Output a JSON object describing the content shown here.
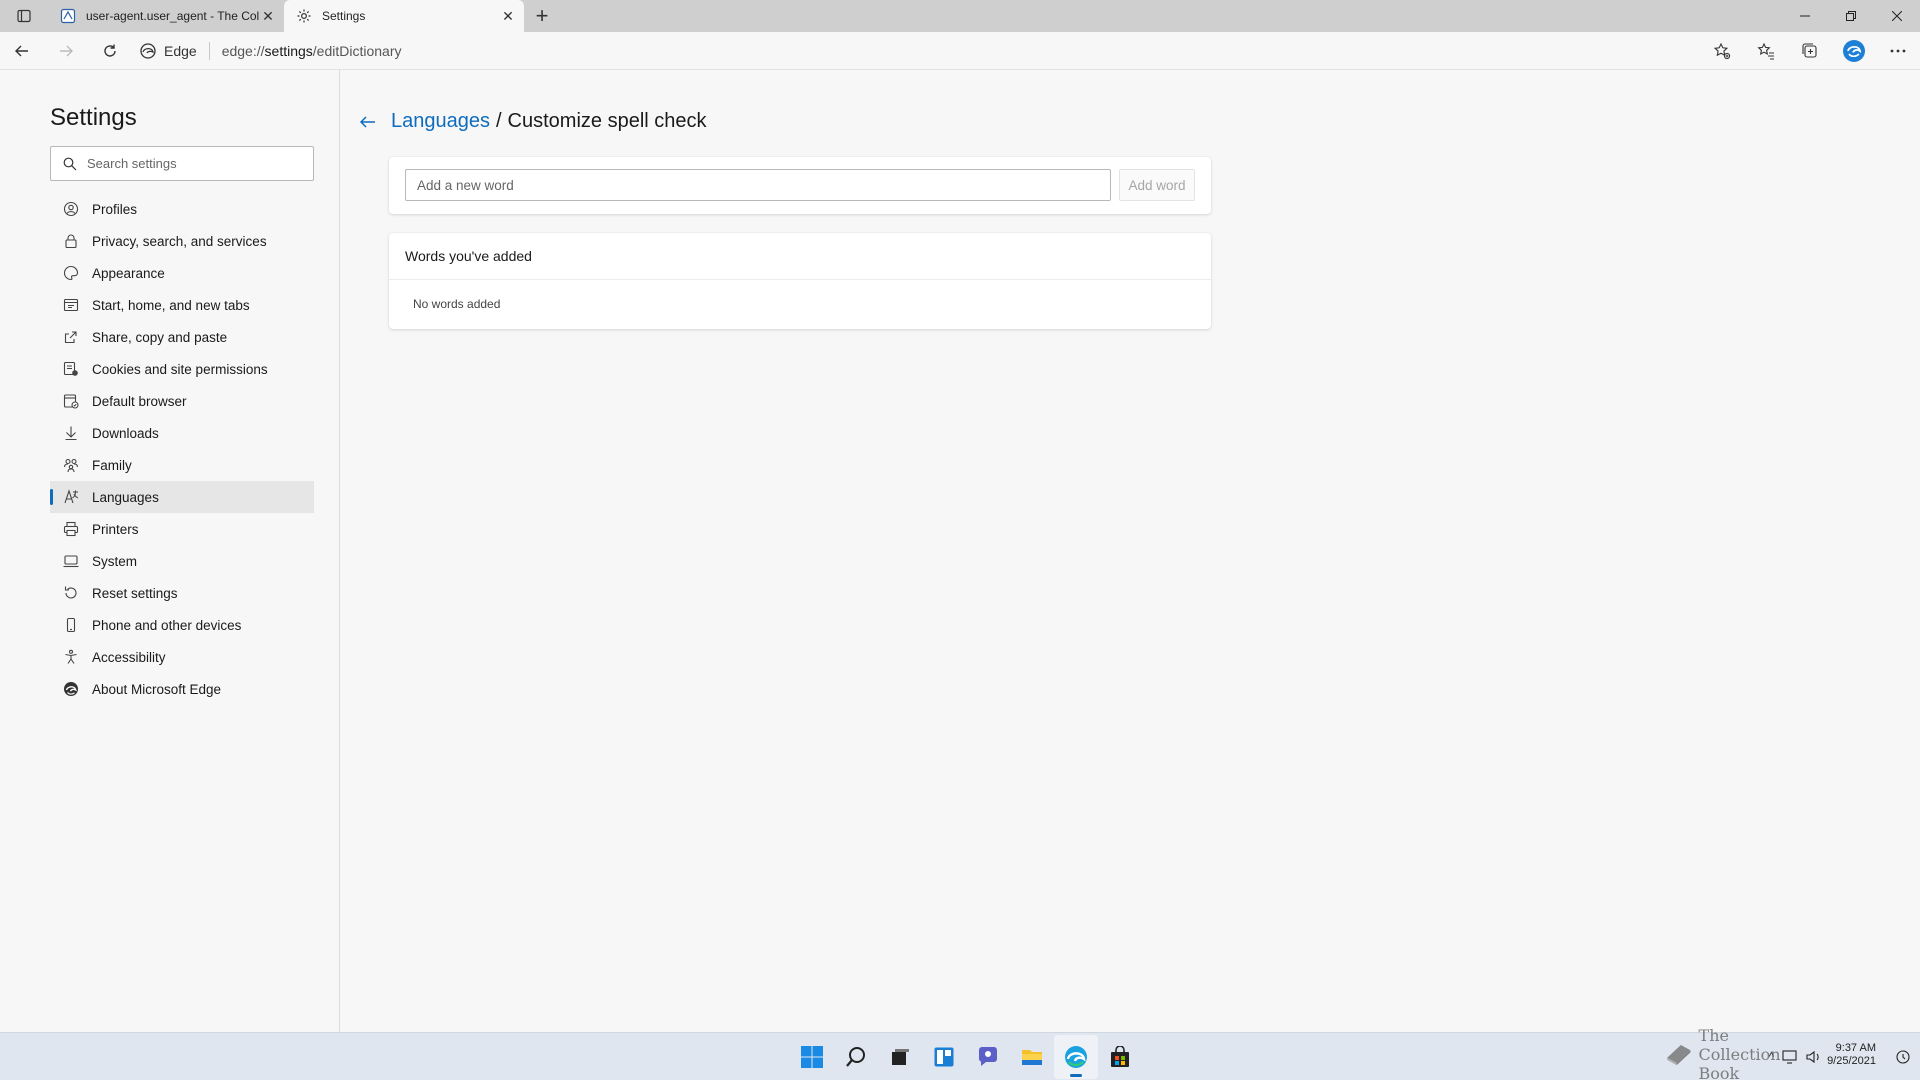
{
  "browser": {
    "tabs": [
      {
        "title": "user-agent.user_agent - The Col",
        "icon": "book-icon"
      },
      {
        "title": "Settings",
        "icon": "gear-icon"
      }
    ],
    "address": {
      "site_label": "Edge",
      "url_prefix": "edge://",
      "url_main": "settings",
      "url_suffix": "/editDictionary"
    }
  },
  "sidebar": {
    "title": "Settings",
    "search_placeholder": "Search settings",
    "items": [
      {
        "label": "Profiles",
        "icon": "profile-icon"
      },
      {
        "label": "Privacy, search, and services",
        "icon": "lock-icon"
      },
      {
        "label": "Appearance",
        "icon": "appearance-icon"
      },
      {
        "label": "Start, home, and new tabs",
        "icon": "start-icon"
      },
      {
        "label": "Share, copy and paste",
        "icon": "share-icon"
      },
      {
        "label": "Cookies and site permissions",
        "icon": "cookies-icon"
      },
      {
        "label": "Default browser",
        "icon": "browser-icon"
      },
      {
        "label": "Downloads",
        "icon": "download-icon"
      },
      {
        "label": "Family",
        "icon": "family-icon"
      },
      {
        "label": "Languages",
        "icon": "languages-icon",
        "selected": true
      },
      {
        "label": "Printers",
        "icon": "printer-icon"
      },
      {
        "label": "System",
        "icon": "system-icon"
      },
      {
        "label": "Reset settings",
        "icon": "reset-icon"
      },
      {
        "label": "Phone and other devices",
        "icon": "phone-icon"
      },
      {
        "label": "Accessibility",
        "icon": "accessibility-icon"
      },
      {
        "label": "About Microsoft Edge",
        "icon": "edge-icon"
      }
    ]
  },
  "main": {
    "breadcrumb_parent": "Languages",
    "breadcrumb_separator": "/",
    "breadcrumb_current": "Customize spell check",
    "add_word_placeholder": "Add a new word",
    "add_word_button": "Add word",
    "words_heading": "Words you've added",
    "words_empty": "No words added"
  },
  "taskbar": {
    "clock_time": "9:37 AM",
    "clock_date": "9/25/2021",
    "watermark_text": "The Collection Book"
  },
  "colors": {
    "accent": "#0f6cbd",
    "selected_bg": "#e6e6e6"
  }
}
